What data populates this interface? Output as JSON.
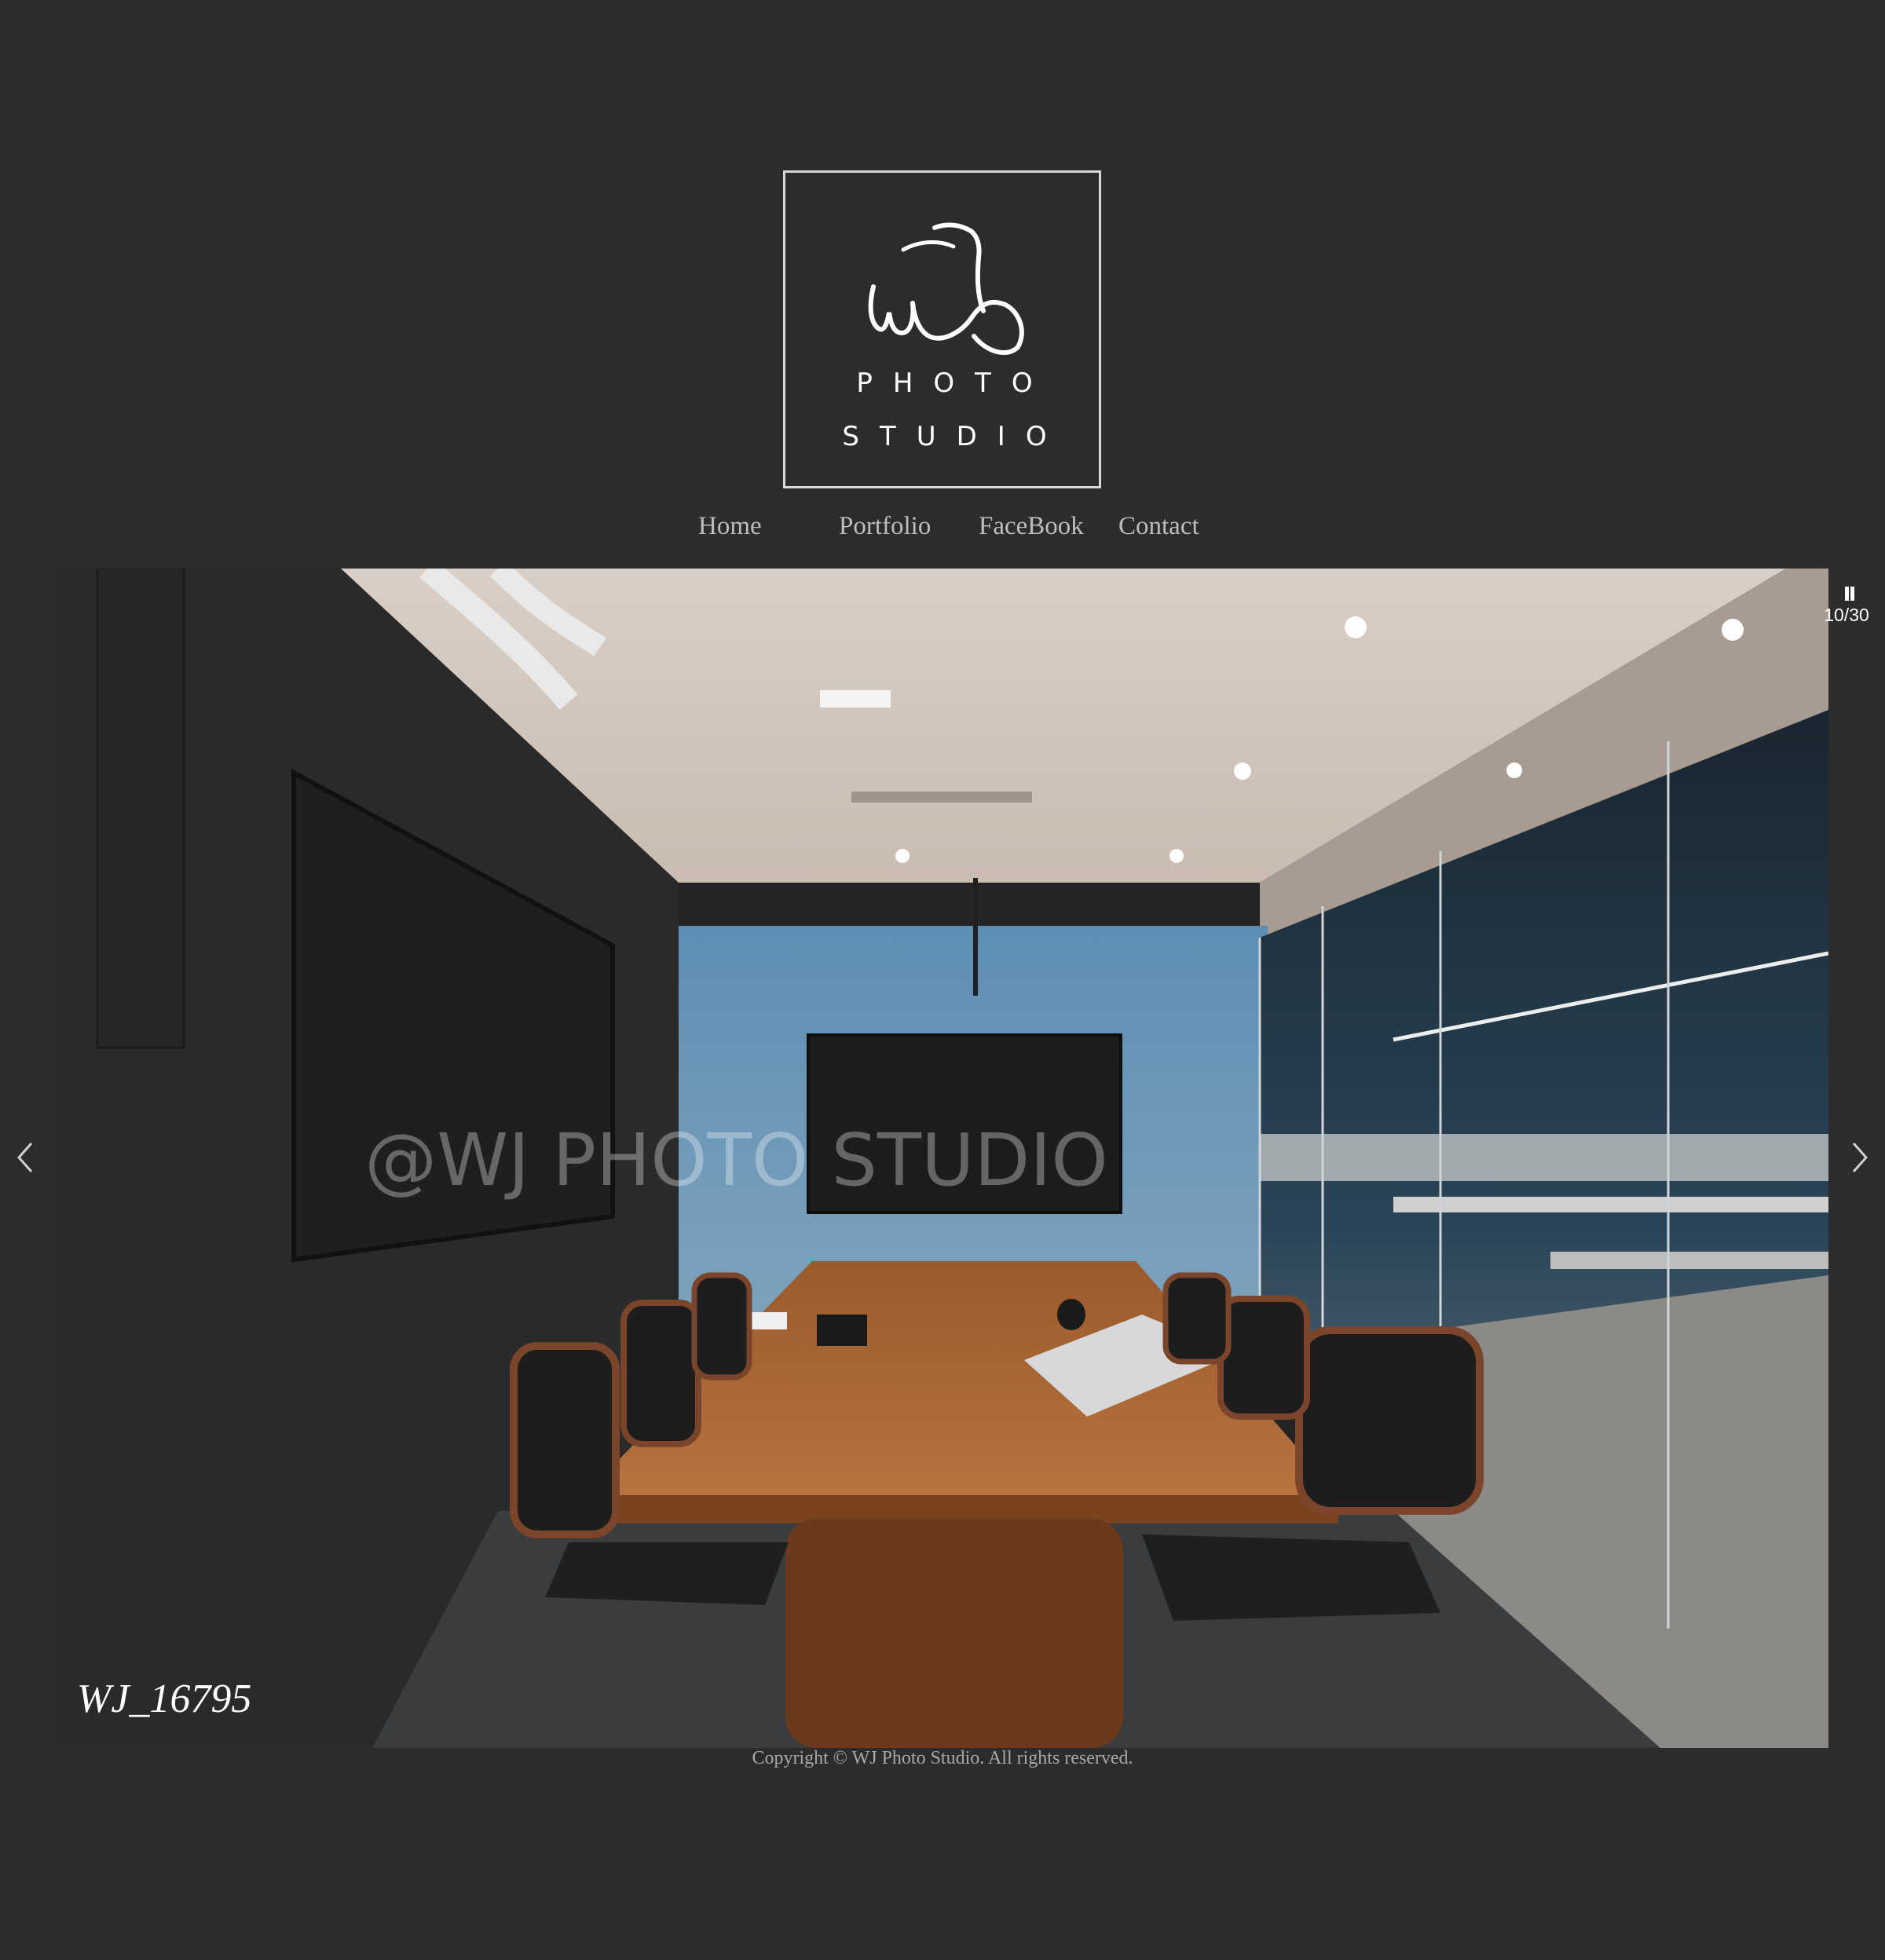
{
  "logo": {
    "line1": "PHOTO",
    "line2": "STUDIO"
  },
  "nav": {
    "items": [
      "Home",
      "Portfolio",
      "FaceBook",
      "Contact"
    ]
  },
  "slideshow": {
    "watermark": "@WJ PHOTO STUDIO",
    "caption": "WJ_16795",
    "counter": "10/30",
    "prev_icon": "chevron-left-icon",
    "next_icon": "chevron-right-icon",
    "pause_icon": "pause-icon"
  },
  "footer": {
    "copyright": "Copyright © WJ Photo Studio. All rights reserved."
  },
  "colors": {
    "background": "#2c2c2c",
    "logo_border": "#d9d9d9",
    "nav_text": "#bdbdbd",
    "footer_text": "#a8a8a8"
  }
}
